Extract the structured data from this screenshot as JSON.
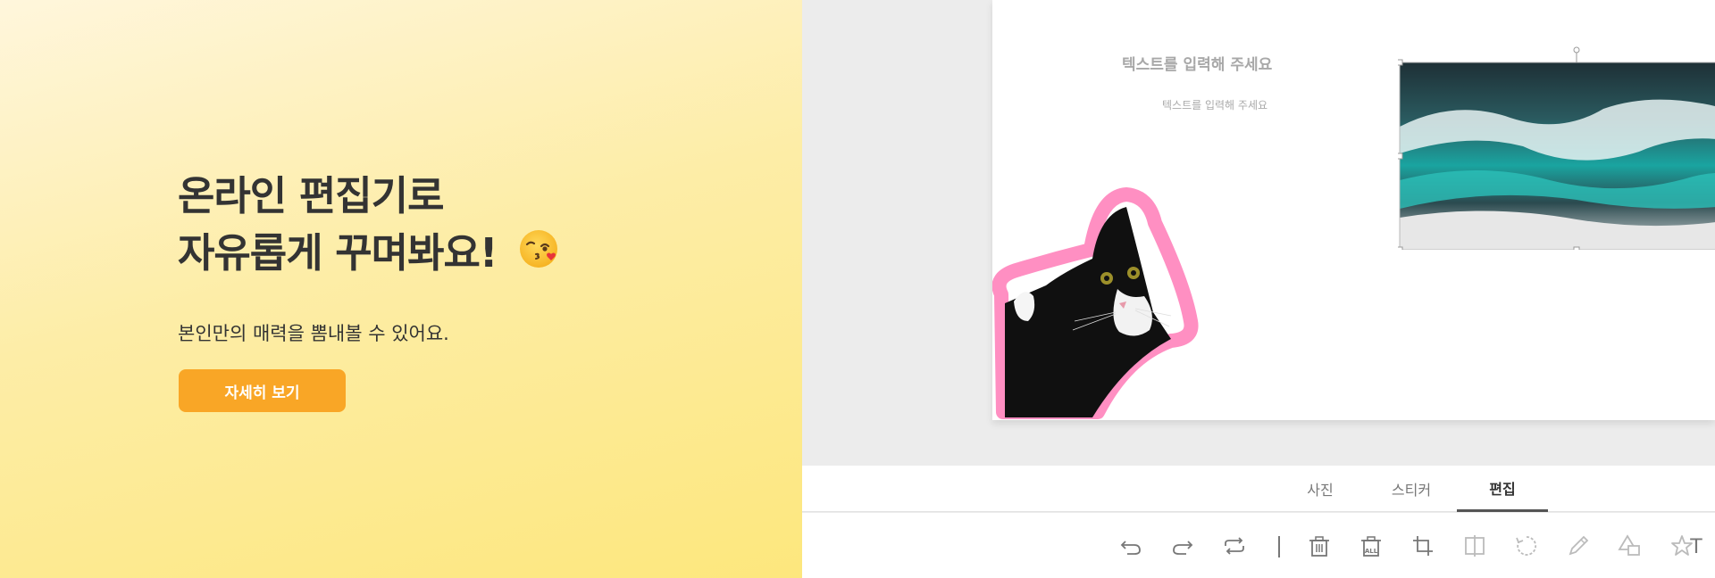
{
  "hero": {
    "title_line1": "온라인 편집기로",
    "title_line2": "자유롭게 꾸며봐요!",
    "title_emoji": "kissing-face-emoji",
    "subtitle": "본인만의 매력을 뽐내볼 수 있어요.",
    "cta_label": "자세히 보기",
    "cta_color": "#f9a626"
  },
  "canvas": {
    "text_box_1": "텍스트를 입력해 주세요",
    "text_box_2": "텍스트를 입력해 주세요",
    "photo": "ocean-wave-photo",
    "sticker": "cat-sticker"
  },
  "tabs": [
    {
      "label": "사진",
      "active": false
    },
    {
      "label": "스티커",
      "active": false
    },
    {
      "label": "편집",
      "active": true
    }
  ],
  "toolbar": {
    "icons": [
      "undo-icon",
      "redo-icon",
      "repeat-icon",
      "separator",
      "delete-icon",
      "delete-all-icon",
      "crop-icon",
      "flip-icon",
      "rotate-icon",
      "pencil-icon",
      "shape-icon",
      "star-icon",
      "text-icon"
    ],
    "delete_all_label": "ALL",
    "text_tool_glyph": "T"
  }
}
